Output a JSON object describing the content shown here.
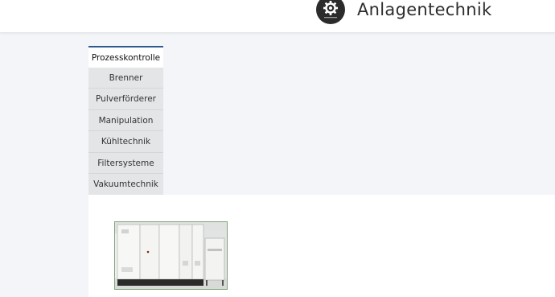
{
  "header": {
    "brand": "Anlagentechnik",
    "logo_icon": "gear-icon"
  },
  "tabs": [
    {
      "label": "Prozesskontrolle",
      "active": true
    },
    {
      "label": "Brenner"
    },
    {
      "label": "Pulverförderer"
    },
    {
      "label": "Manipulation"
    },
    {
      "label": "Kühltechnik"
    },
    {
      "label": "Filtersysteme"
    },
    {
      "label": "Vakuumtechnik"
    }
  ],
  "colors": {
    "accent": "#2f5a8c",
    "tab_bg": "#e4e5e7",
    "page_bg": "#f4f5f8"
  }
}
